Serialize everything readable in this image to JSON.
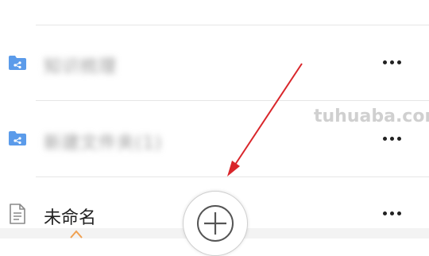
{
  "files": [
    {
      "type": "folder",
      "name": "知识梳理",
      "blurred": true
    },
    {
      "type": "folder",
      "name": "新建文件夹(1)",
      "blurred": true
    },
    {
      "type": "doc",
      "name": "未命名",
      "blurred": false
    }
  ],
  "watermark": "tuhuaba.com",
  "colors": {
    "folder": "#5b9bea",
    "annotation_arrow": "#d9262b",
    "divider": "#e6e6e6"
  },
  "icons": {
    "folder": "shared-folder-icon",
    "doc": "document-icon",
    "more": "more-horizontal-icon",
    "add": "plus-icon"
  }
}
